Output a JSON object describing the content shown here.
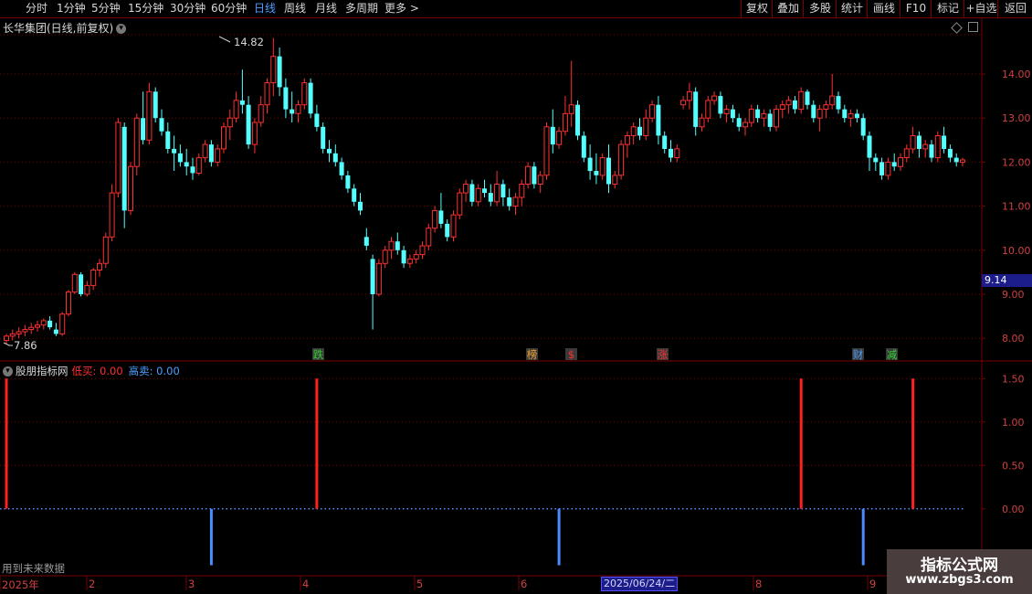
{
  "toolbar": {
    "periods": [
      "分时",
      "1分钟",
      "5分钟",
      "15分钟",
      "30分钟",
      "60分钟",
      "日线",
      "周线",
      "月线",
      "多周期",
      "更多 >"
    ],
    "active_period": "日线",
    "right_buttons": [
      "复权",
      "叠加",
      "多股",
      "统计",
      "画线",
      "F10",
      "标记",
      "+自选",
      "返回"
    ]
  },
  "chart_title": "长华集团(日线,前复权)",
  "price_axis": [
    "14.00",
    "13.00",
    "12.00",
    "11.00",
    "10.00",
    "9.00",
    "8.00"
  ],
  "current_price_tag": "9.14",
  "high_marker": "14.82",
  "low_marker": "7.86",
  "event_badges": [
    {
      "text": "跌",
      "color": "#30d030"
    },
    {
      "text": "榜",
      "color": "#f0a030"
    },
    {
      "text": "$",
      "color": "#ff3030"
    },
    {
      "text": "涨",
      "color": "#ff3030"
    },
    {
      "text": "财",
      "color": "#4aa0ff"
    },
    {
      "text": "减",
      "color": "#30d030"
    }
  ],
  "indicator": {
    "name": "股朋指标网",
    "low_buy_label": "低买:",
    "low_buy_value": "0.00",
    "high_sell_label": "高卖:",
    "high_sell_value": "0.00",
    "axis": [
      "1.50",
      "1.00",
      "0.50",
      "0.00"
    ]
  },
  "future_note": "用到未来数据",
  "x_labels": [
    "2025年",
    "2",
    "3",
    "4",
    "5",
    "6",
    "8",
    "9"
  ],
  "cursor_date": "2025/06/24/二",
  "watermark": {
    "line1": "指标公式网",
    "line2": "www.zbgs3.com"
  },
  "colors": {
    "up": "#ff3030",
    "down": "#54ffff",
    "grid": "#7a0000",
    "low_buy": "#ff2020",
    "high_sell": "#4a8cff"
  },
  "chart_data": {
    "type": "candlestick",
    "y_range": [
      7.7,
      14.9
    ],
    "ohlc": [
      [
        7.95,
        8.1,
        7.86,
        8.05
      ],
      [
        8.05,
        8.2,
        7.95,
        8.1
      ],
      [
        8.1,
        8.25,
        8.0,
        8.15
      ],
      [
        8.15,
        8.3,
        8.05,
        8.2
      ],
      [
        8.2,
        8.35,
        8.1,
        8.25
      ],
      [
        8.25,
        8.4,
        8.15,
        8.3
      ],
      [
        8.3,
        8.45,
        8.2,
        8.4
      ],
      [
        8.4,
        8.5,
        8.2,
        8.25
      ],
      [
        8.2,
        8.35,
        8.05,
        8.1
      ],
      [
        8.1,
        8.6,
        8.05,
        8.55
      ],
      [
        8.55,
        9.1,
        8.5,
        9.05
      ],
      [
        9.05,
        9.5,
        9.0,
        9.45
      ],
      [
        9.45,
        9.5,
        8.95,
        9.0
      ],
      [
        9.0,
        9.3,
        8.95,
        9.2
      ],
      [
        9.2,
        9.6,
        9.1,
        9.55
      ],
      [
        9.55,
        9.8,
        9.4,
        9.7
      ],
      [
        9.7,
        10.4,
        9.6,
        10.3
      ],
      [
        10.3,
        11.5,
        10.2,
        11.3
      ],
      [
        11.3,
        13.0,
        11.2,
        12.9
      ],
      [
        12.8,
        12.9,
        10.5,
        10.9
      ],
      [
        10.9,
        12.0,
        10.8,
        11.9
      ],
      [
        11.9,
        13.1,
        11.7,
        13.0
      ],
      [
        13.0,
        13.6,
        12.4,
        12.5
      ],
      [
        12.5,
        13.8,
        12.4,
        13.6
      ],
      [
        13.6,
        13.7,
        12.9,
        13.0
      ],
      [
        13.0,
        13.2,
        12.6,
        12.7
      ],
      [
        12.7,
        12.9,
        12.2,
        12.3
      ],
      [
        12.3,
        12.6,
        11.8,
        12.2
      ],
      [
        12.2,
        12.4,
        11.9,
        12.0
      ],
      [
        12.0,
        12.3,
        11.7,
        11.9
      ],
      [
        11.9,
        12.1,
        11.6,
        11.75
      ],
      [
        11.75,
        12.2,
        11.7,
        12.1
      ],
      [
        12.1,
        12.5,
        12.0,
        12.4
      ],
      [
        12.4,
        12.5,
        11.9,
        12.0
      ],
      [
        12.0,
        12.4,
        11.9,
        12.3
      ],
      [
        12.3,
        12.9,
        12.2,
        12.8
      ],
      [
        12.8,
        13.2,
        12.5,
        13.0
      ],
      [
        13.0,
        13.6,
        12.9,
        13.4
      ],
      [
        13.4,
        14.1,
        13.1,
        13.3
      ],
      [
        13.3,
        13.5,
        12.3,
        12.4
      ],
      [
        12.4,
        13.0,
        12.2,
        12.9
      ],
      [
        12.9,
        13.5,
        12.8,
        13.3
      ],
      [
        13.3,
        13.9,
        13.1,
        13.8
      ],
      [
        13.8,
        14.82,
        13.5,
        14.4
      ],
      [
        14.4,
        14.6,
        13.5,
        13.7
      ],
      [
        13.7,
        13.9,
        13.0,
        13.2
      ],
      [
        13.2,
        13.6,
        12.9,
        13.1
      ],
      [
        13.1,
        13.4,
        12.9,
        13.3
      ],
      [
        13.3,
        13.9,
        13.2,
        13.8
      ],
      [
        13.8,
        13.9,
        13.0,
        13.1
      ],
      [
        13.1,
        13.3,
        12.7,
        12.8
      ],
      [
        12.8,
        12.9,
        12.2,
        12.3
      ],
      [
        12.3,
        12.5,
        12.0,
        12.2
      ],
      [
        12.2,
        12.4,
        11.9,
        12.0
      ],
      [
        12.0,
        12.1,
        11.6,
        11.7
      ],
      [
        11.7,
        11.8,
        11.3,
        11.4
      ],
      [
        11.4,
        11.5,
        11.0,
        11.1
      ],
      [
        11.1,
        11.3,
        10.8,
        10.9
      ],
      [
        10.3,
        10.5,
        10.0,
        10.1
      ],
      [
        9.8,
        9.9,
        8.2,
        9.0
      ],
      [
        9.0,
        9.8,
        8.95,
        9.7
      ],
      [
        9.7,
        10.1,
        9.6,
        10.0
      ],
      [
        10.0,
        10.3,
        9.8,
        10.2
      ],
      [
        10.2,
        10.4,
        9.9,
        10.0
      ],
      [
        10.0,
        10.1,
        9.6,
        9.7
      ],
      [
        9.7,
        9.9,
        9.6,
        9.8
      ],
      [
        9.8,
        10.0,
        9.7,
        9.9
      ],
      [
        9.9,
        10.2,
        9.8,
        10.1
      ],
      [
        10.1,
        10.6,
        10.0,
        10.5
      ],
      [
        10.5,
        11.0,
        10.4,
        10.9
      ],
      [
        10.9,
        11.3,
        10.5,
        10.6
      ],
      [
        10.6,
        10.7,
        10.2,
        10.3
      ],
      [
        10.3,
        10.9,
        10.2,
        10.8
      ],
      [
        10.8,
        11.4,
        10.7,
        11.3
      ],
      [
        11.3,
        11.6,
        11.1,
        11.5
      ],
      [
        11.5,
        11.6,
        11.0,
        11.1
      ],
      [
        11.1,
        11.5,
        11.0,
        11.4
      ],
      [
        11.4,
        11.6,
        11.2,
        11.3
      ],
      [
        11.3,
        11.5,
        11.0,
        11.1
      ],
      [
        11.1,
        11.8,
        11.0,
        11.5
      ],
      [
        11.5,
        11.6,
        11.0,
        11.2
      ],
      [
        11.2,
        11.4,
        10.9,
        11.0
      ],
      [
        11.0,
        11.3,
        10.8,
        11.2
      ],
      [
        11.2,
        11.6,
        11.0,
        11.5
      ],
      [
        11.5,
        12.0,
        11.4,
        11.9
      ],
      [
        11.9,
        12.0,
        11.4,
        11.5
      ],
      [
        11.5,
        11.8,
        11.3,
        11.7
      ],
      [
        11.7,
        12.9,
        11.6,
        12.8
      ],
      [
        12.8,
        13.2,
        12.2,
        12.4
      ],
      [
        12.4,
        12.8,
        12.3,
        12.7
      ],
      [
        12.7,
        13.5,
        12.6,
        13.1
      ],
      [
        13.1,
        14.3,
        12.8,
        13.3
      ],
      [
        13.3,
        13.4,
        12.5,
        12.6
      ],
      [
        12.6,
        12.7,
        12.0,
        12.1
      ],
      [
        12.1,
        12.4,
        11.6,
        11.8
      ],
      [
        11.8,
        12.2,
        11.5,
        11.7
      ],
      [
        11.7,
        12.2,
        11.6,
        12.1
      ],
      [
        12.1,
        12.4,
        11.3,
        11.5
      ],
      [
        11.5,
        11.8,
        11.4,
        11.7
      ],
      [
        11.7,
        12.5,
        11.6,
        12.4
      ],
      [
        12.4,
        12.7,
        12.1,
        12.6
      ],
      [
        12.6,
        12.9,
        12.4,
        12.8
      ],
      [
        12.8,
        13.0,
        12.5,
        12.6
      ],
      [
        12.6,
        13.2,
        12.5,
        13.0
      ],
      [
        13.0,
        13.4,
        12.9,
        13.3
      ],
      [
        13.3,
        13.5,
        12.4,
        12.6
      ],
      [
        12.6,
        12.7,
        12.2,
        12.3
      ],
      [
        12.3,
        12.5,
        12.0,
        12.1
      ],
      [
        12.1,
        12.4,
        12.0,
        12.3
      ],
      [
        13.3,
        13.5,
        13.2,
        13.4
      ],
      [
        13.4,
        13.8,
        13.2,
        13.6
      ],
      [
        13.6,
        13.7,
        12.6,
        12.8
      ],
      [
        12.8,
        13.1,
        12.7,
        13.0
      ],
      [
        13.0,
        13.5,
        12.9,
        13.4
      ],
      [
        13.4,
        13.6,
        13.3,
        13.5
      ],
      [
        13.5,
        13.6,
        13.0,
        13.1
      ],
      [
        13.1,
        13.3,
        12.9,
        13.2
      ],
      [
        13.2,
        13.3,
        12.9,
        13.0
      ],
      [
        13.0,
        13.1,
        12.7,
        12.8
      ],
      [
        12.8,
        13.0,
        12.6,
        12.9
      ],
      [
        12.9,
        13.3,
        12.8,
        13.2
      ],
      [
        13.2,
        13.3,
        12.9,
        13.0
      ],
      [
        13.0,
        13.2,
        12.8,
        13.1
      ],
      [
        13.1,
        13.2,
        12.7,
        12.8
      ],
      [
        12.8,
        13.3,
        12.7,
        13.2
      ],
      [
        13.2,
        13.4,
        13.0,
        13.3
      ],
      [
        13.3,
        13.5,
        13.1,
        13.4
      ],
      [
        13.4,
        13.5,
        13.1,
        13.2
      ],
      [
        13.2,
        13.7,
        13.1,
        13.6
      ],
      [
        13.6,
        13.65,
        13.2,
        13.3
      ],
      [
        13.3,
        13.4,
        12.9,
        13.0
      ],
      [
        13.0,
        13.3,
        12.7,
        13.2
      ],
      [
        13.2,
        13.4,
        13.0,
        13.3
      ],
      [
        13.3,
        14.0,
        13.2,
        13.5
      ],
      [
        13.5,
        13.6,
        13.1,
        13.2
      ],
      [
        13.2,
        13.3,
        12.9,
        13.0
      ],
      [
        13.0,
        13.2,
        12.8,
        13.1
      ],
      [
        13.1,
        13.2,
        12.9,
        13.0
      ],
      [
        13.0,
        13.1,
        12.5,
        12.6
      ],
      [
        12.6,
        12.7,
        11.8,
        12.1
      ],
      [
        12.1,
        12.2,
        11.8,
        12.0
      ],
      [
        12.0,
        12.1,
        11.6,
        11.7
      ],
      [
        11.7,
        12.1,
        11.6,
        12.0
      ],
      [
        12.0,
        12.2,
        11.8,
        11.9
      ],
      [
        11.9,
        12.2,
        11.8,
        12.1
      ],
      [
        12.1,
        12.4,
        12.0,
        12.3
      ],
      [
        12.3,
        12.8,
        12.2,
        12.6
      ],
      [
        12.6,
        12.7,
        12.1,
        12.3
      ],
      [
        12.3,
        12.5,
        12.1,
        12.4
      ],
      [
        12.4,
        12.5,
        12.0,
        12.1
      ],
      [
        12.1,
        12.7,
        12.0,
        12.6
      ],
      [
        12.6,
        12.8,
        12.2,
        12.3
      ],
      [
        12.3,
        12.4,
        12.0,
        12.1
      ],
      [
        12.1,
        12.2,
        11.9,
        12.0
      ],
      [
        12.0,
        12.1,
        11.9,
        12.05
      ]
    ],
    "low_buy_signals": [
      0,
      50,
      128,
      146
    ],
    "high_sell_signals": [
      33,
      89,
      138
    ],
    "signal_levels": {
      "low_buy": 1.5,
      "high_sell": -0.65
    },
    "indicator_y_range": [
      -0.75,
      1.65
    ]
  }
}
